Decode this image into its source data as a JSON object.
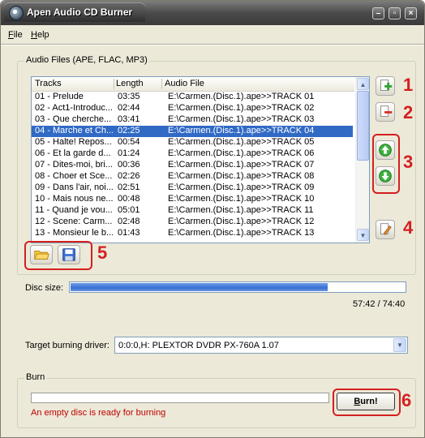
{
  "window": {
    "title": "Apen Audio CD Burner",
    "controls": {
      "minimize": "0",
      "restore": "□",
      "close": "×"
    }
  },
  "menu": [
    {
      "label": "File",
      "mnemonic": "F",
      "rest": "ile"
    },
    {
      "label": "Help",
      "mnemonic": "H",
      "rest": "elp"
    }
  ],
  "audio_files": {
    "group_label": "Audio Files (APE, FLAC, MP3)",
    "columns": [
      "Tracks",
      "Length",
      "Audio File"
    ],
    "rows": [
      {
        "track": "01 - Prelude",
        "length": "03:35",
        "file": "E:\\Carmen.(Disc.1).ape>>TRACK 01",
        "selected": false
      },
      {
        "track": "02 - Act1-Introduc...",
        "length": "02:44",
        "file": "E:\\Carmen.(Disc.1).ape>>TRACK 02",
        "selected": false
      },
      {
        "track": "03 - Que cherche...",
        "length": "03:41",
        "file": "E:\\Carmen.(Disc.1).ape>>TRACK 03",
        "selected": false
      },
      {
        "track": "04 - Marche et Ch...",
        "length": "02:25",
        "file": "E:\\Carmen.(Disc.1).ape>>TRACK 04",
        "selected": true
      },
      {
        "track": "05 - Halte! Repos...",
        "length": "00:54",
        "file": "E:\\Carmen.(Disc.1).ape>>TRACK 05",
        "selected": false
      },
      {
        "track": "06 - Et la garde d...",
        "length": "01:24",
        "file": "E:\\Carmen.(Disc.1).ape>>TRACK 06",
        "selected": false
      },
      {
        "track": "07 - Dites-moi, bri...",
        "length": "00:36",
        "file": "E:\\Carmen.(Disc.1).ape>>TRACK 07",
        "selected": false
      },
      {
        "track": "08 - Choer et Sce...",
        "length": "02:26",
        "file": "E:\\Carmen.(Disc.1).ape>>TRACK 08",
        "selected": false
      },
      {
        "track": "09 - Dans l'air, noi...",
        "length": "02:51",
        "file": "E:\\Carmen.(Disc.1).ape>>TRACK 09",
        "selected": false
      },
      {
        "track": "10 - Mais nous ne...",
        "length": "00:48",
        "file": "E:\\Carmen.(Disc.1).ape>>TRACK 10",
        "selected": false
      },
      {
        "track": "11 - Quand je vou...",
        "length": "05:01",
        "file": "E:\\Carmen.(Disc.1).ape>>TRACK 11",
        "selected": false
      },
      {
        "track": "12 - Scene: Carm...",
        "length": "02:48",
        "file": "E:\\Carmen.(Disc.1).ape>>TRACK 12",
        "selected": false
      },
      {
        "track": "13 - Monsieur le b...",
        "length": "01:43",
        "file": "E:\\Carmen.(Disc.1).ape>>TRACK 13",
        "selected": false
      }
    ]
  },
  "side_buttons": [
    {
      "name": "add-file-button",
      "icon": "add-file-icon"
    },
    {
      "name": "remove-file-button",
      "icon": "remove-file-icon"
    },
    {
      "name": "move-up-button",
      "icon": "arrow-up-icon"
    },
    {
      "name": "move-down-button",
      "icon": "arrow-down-icon"
    },
    {
      "name": "edit-file-button",
      "icon": "edit-file-icon"
    }
  ],
  "bottom_buttons": [
    {
      "name": "open-project-button",
      "icon": "folder-icon"
    },
    {
      "name": "save-project-button",
      "icon": "floppy-disk-icon"
    }
  ],
  "annotations": [
    "1",
    "2",
    "3",
    "4",
    "5",
    "6"
  ],
  "disc": {
    "label": "Disc size:",
    "used_time": "57:42 / 74:40",
    "fill_fraction": 0.77
  },
  "target": {
    "label": "Target burning driver:",
    "value": "0:0:0,H: PLEXTOR  DVDR   PX-760A   1.07"
  },
  "burn": {
    "group_label": "Burn",
    "button_label": "Burn!",
    "button_mnemonic": "B",
    "button_rest": "urn!",
    "status": "An empty disc is ready for burning",
    "progress_fraction": 0.0
  },
  "colors": {
    "accent_red": "#d42020",
    "selection": "#316ac5",
    "status_red": "#c00000"
  }
}
